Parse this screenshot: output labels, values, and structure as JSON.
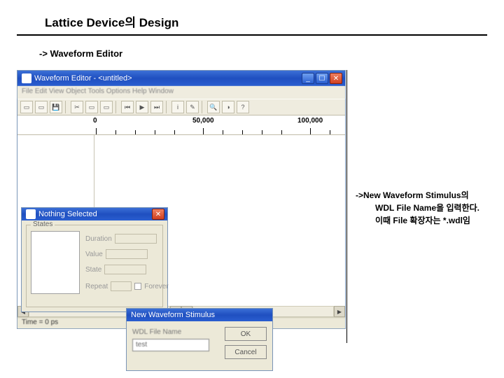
{
  "page": {
    "title": "Lattice Device의 Design",
    "subtitle": "-> Waveform Editor"
  },
  "annotation": {
    "line1": "->New Waveform Stimulus의",
    "line2": "WDL File Name을 입력한다.",
    "line3": "이때 File 확장자는 *.wdl임"
  },
  "wfe": {
    "title": "Waveform Editor - <untitled>",
    "menubar": "File  Edit  View  Object  Tools  Options  Help  Window",
    "ruler": {
      "t0": "0",
      "t1": "50,000",
      "t2": "100,000"
    },
    "status": "Time = 0 ps"
  },
  "nsel": {
    "title": "Nothing Selected",
    "group": "States",
    "f1": "Duration",
    "f2": "Value",
    "f3": "State",
    "f4a": "Repeat",
    "f4b": "Forever"
  },
  "nws": {
    "title": "New Waveform Stimulus",
    "label": "WDL File Name",
    "value": "test",
    "ok": "OK",
    "cancel": "Cancel"
  }
}
